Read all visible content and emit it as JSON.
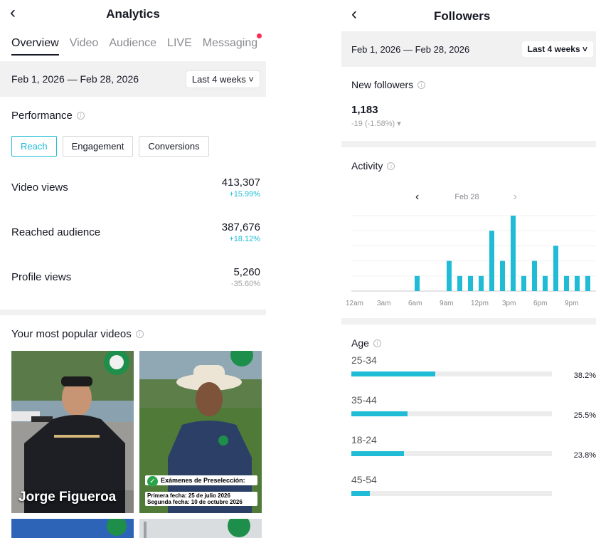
{
  "left": {
    "title": "Analytics",
    "tabs": [
      "Overview",
      "Video",
      "Audience",
      "LIVE",
      "Messaging"
    ],
    "date_range": "Feb 1, 2026 — Feb 28, 2026",
    "period": "Last 4 weeks ˅",
    "performance_label": "Performance",
    "chips": [
      "Reach",
      "Engagement",
      "Conversions"
    ],
    "metrics": [
      {
        "name": "Video views",
        "value": "413,307",
        "change": "+15.99%"
      },
      {
        "name": "Reached audience",
        "value": "387,676",
        "change": "+18.12%"
      },
      {
        "name": "Profile views",
        "value": "5,260",
        "change": "-35.60%"
      }
    ],
    "popular_label": "Your most popular videos",
    "video1_caption": "Jorge Figueroa",
    "video2_caption_title": "Exámenes de Preselección:",
    "video2_caption_line1": "Primera fecha: 25 de julio 2026",
    "video2_caption_line2": "Segunda fecha: 10 de octubre 2026"
  },
  "right": {
    "title": "Followers",
    "date_range": "Feb 1, 2026 — Feb 28, 2026",
    "period": "Last 4 weeks ˅",
    "new_followers_label": "New followers",
    "new_followers_value": "1,183",
    "new_followers_change": "-19 (-1.58%) ▾",
    "activity_label": "Activity",
    "activity_date": "Feb 28",
    "age_label": "Age",
    "ages": [
      {
        "label": "25-34",
        "pct": "38.2%",
        "value": 38.2
      },
      {
        "label": "35-44",
        "pct": "25.5%",
        "value": 25.5
      },
      {
        "label": "18-24",
        "pct": "23.8%",
        "value": 23.8
      },
      {
        "label": "45-54",
        "pct": "",
        "value": 8.3
      }
    ]
  },
  "chart_data": {
    "type": "bar",
    "categories": [
      "0",
      "1",
      "2",
      "3",
      "4",
      "5",
      "6",
      "7",
      "8",
      "9",
      "10",
      "11",
      "12",
      "13",
      "14",
      "15",
      "16",
      "17",
      "18",
      "19",
      "20",
      "21",
      "22"
    ],
    "x_tick_labels": [
      "12am",
      "3am",
      "6am",
      "9am",
      "12pm",
      "3pm",
      "6pm",
      "9pm"
    ],
    "values": [
      0,
      0,
      0,
      0,
      0,
      2,
      0,
      0,
      4,
      2,
      2,
      2,
      8,
      4,
      10,
      2,
      4,
      2,
      6,
      2,
      2,
      2,
      4
    ],
    "ylim": [
      0,
      10
    ],
    "grid": true,
    "color": "#20bcd6"
  },
  "colors": {
    "accent": "#20bcd6",
    "alert": "#fe2c55",
    "muted": "#a0a1a5"
  }
}
